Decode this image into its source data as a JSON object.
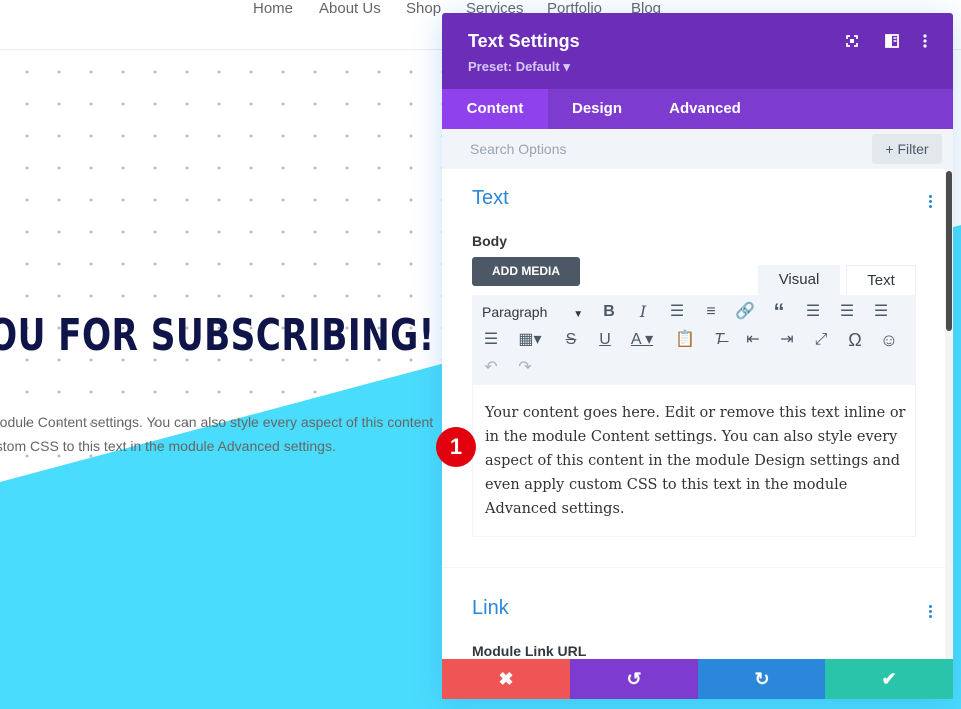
{
  "site": {
    "nav": [
      "Home",
      "About Us",
      "Shop",
      "Services",
      "Portfolio",
      "Blog"
    ],
    "heading": "OU FOR SUBSCRIBING!",
    "body_line1": "module Content settings. You can also style every aspect of this content",
    "body_line2": "ustom CSS to this text in the module Advanced settings.",
    "accent_color": "#4adcfd"
  },
  "panel": {
    "title": "Text Settings",
    "preset": "Preset: Default ▾",
    "header_icons": [
      "fullscreen-icon",
      "sidebar-icon",
      "more-vertical-icon"
    ],
    "tabs": [
      "Content",
      "Design",
      "Advanced"
    ],
    "active_tab": "Content",
    "search_placeholder": "Search Options",
    "filter_label": "+ Filter",
    "colors": {
      "header": "#6c2eb9",
      "tabs": "#7e3bd0",
      "active_tab": "#8f42ec",
      "section_title": "#2b87da"
    }
  },
  "text_section": {
    "title": "Text",
    "body_label": "Body",
    "add_media": "ADD MEDIA",
    "modes": [
      "Visual",
      "Text"
    ],
    "paragraph_select": "Paragraph",
    "toolbar_icons": [
      "bold-icon",
      "italic-icon",
      "bullet-list-icon",
      "numbered-list-icon",
      "link-icon",
      "blockquote-icon",
      "align-left-icon",
      "align-center-icon",
      "align-right-icon",
      "justify-icon",
      "table-icon",
      "strikethrough-icon",
      "underline-icon",
      "text-color-icon",
      "paste-icon",
      "clear-format-icon",
      "outdent-icon",
      "indent-icon",
      "fullscreen-icon",
      "special-char-icon",
      "emoji-icon",
      "undo-icon",
      "redo-icon"
    ],
    "content": "Your content goes here. Edit or remove this text inline or in the module Content settings. You can also style every aspect of this content in the module Design settings and even apply custom CSS to this text in the module Advanced settings."
  },
  "link_section": {
    "title": "Link",
    "url_label": "Module Link URL"
  },
  "footer": {
    "buttons": [
      {
        "name": "discard",
        "icon": "close-icon",
        "color": "#ef5555"
      },
      {
        "name": "undo",
        "icon": "undo-icon",
        "color": "#7e3bd0"
      },
      {
        "name": "redo",
        "icon": "redo-icon",
        "color": "#2b87da"
      },
      {
        "name": "save",
        "icon": "check-icon",
        "color": "#29c4a9"
      }
    ]
  },
  "annotation": {
    "step": "1"
  }
}
